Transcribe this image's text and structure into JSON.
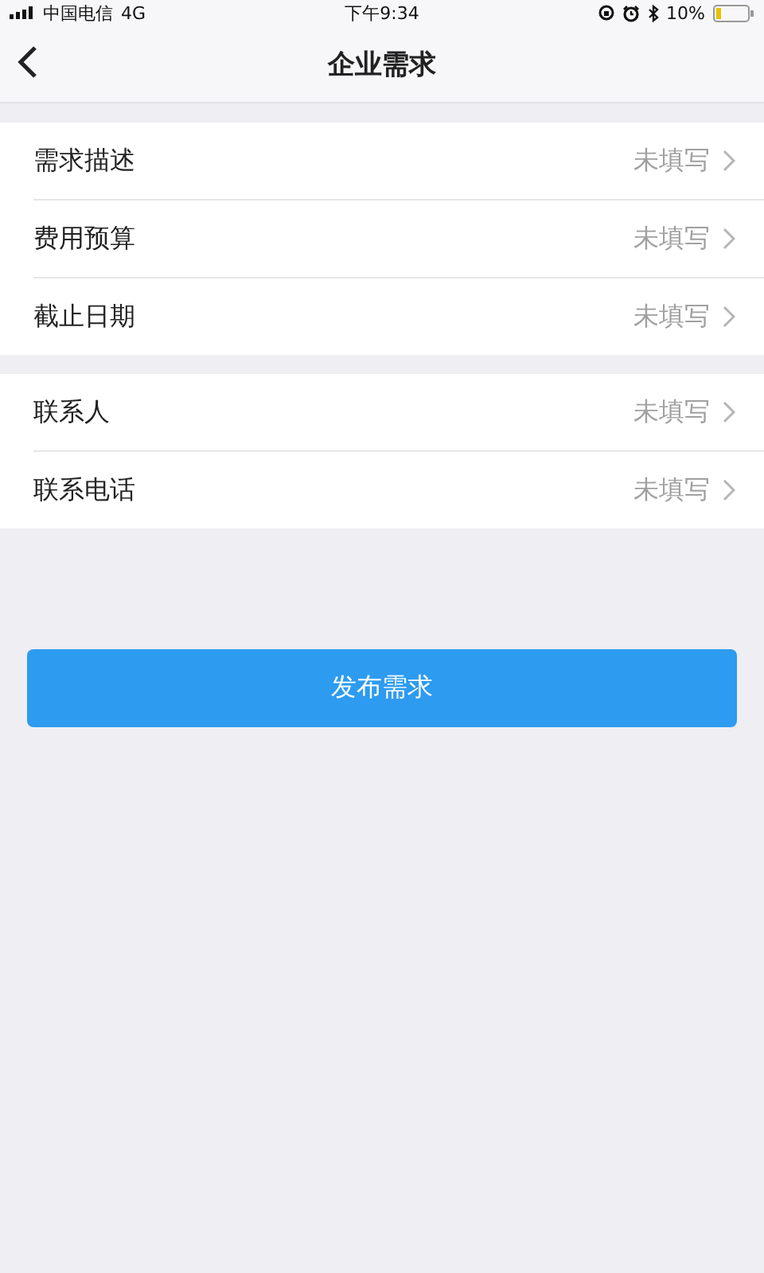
{
  "status_bar": {
    "carrier": "中国电信",
    "network": "4G",
    "time": "下午9:34",
    "battery": "10%"
  },
  "header": {
    "title": "企业需求"
  },
  "groups": [
    {
      "rows": [
        {
          "label": "需求描述",
          "value": "未填写"
        },
        {
          "label": "费用预算",
          "value": "未填写"
        },
        {
          "label": "截止日期",
          "value": "未填写"
        }
      ]
    },
    {
      "rows": [
        {
          "label": "联系人",
          "value": "未填写"
        },
        {
          "label": "联系电话",
          "value": "未填写"
        }
      ]
    }
  ],
  "submit_button": "发布需求"
}
